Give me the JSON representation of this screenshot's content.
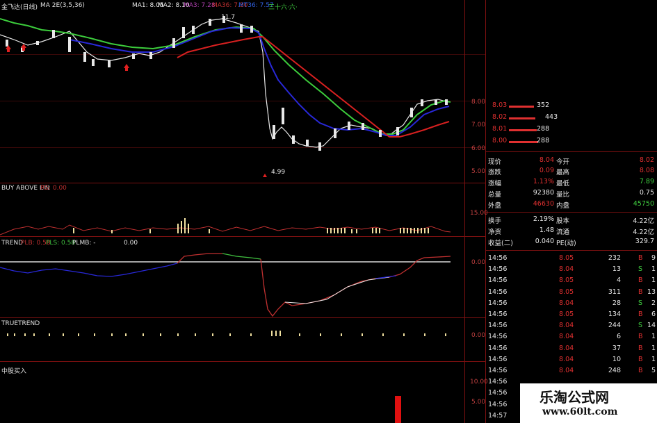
{
  "main_chart": {
    "title": "金飞达(日线)",
    "ma_name": "MA 2E(3,5,36)",
    "ma1": "MA1: 8.05",
    "ma2": "MA2: 8.10",
    "ma3": "MA3: 7.28",
    "ma36": "MA36: 7.30",
    "ma_extra": "MT36: 7.57",
    "signal_text": "三十六·六·",
    "high_label": "11.7",
    "low_label": "4.99",
    "y_ticks": [
      "8.00",
      "7.00",
      "6.00",
      "5.00"
    ],
    "colors": {
      "green": "#3ccc3c",
      "blue": "#2828d8",
      "red": "#d82020",
      "white": "#e8e8e8"
    }
  },
  "buy_panel": {
    "title": "BUY ABOVE LIN",
    "rs": "RS: 0.00",
    "y_tick": "15.00"
  },
  "trend_panel": {
    "title": "TREND",
    "plb": "PLB: 0.58",
    "pls": "PLS: 0.58",
    "plmb": "PLMB: -",
    "plmb_val": "0.00",
    "y_tick": "0.00"
  },
  "truetrend_panel": {
    "title": "TRUETREND",
    "y_tick": "0.00"
  },
  "bottom_panel": {
    "title": "中股买入",
    "y_ticks": [
      "10.00",
      "5.00"
    ]
  },
  "order_book": [
    {
      "price": "8.03",
      "vol": "352"
    },
    {
      "price": "8.02",
      "vol": "443"
    },
    {
      "price": "8.01",
      "vol": "288"
    },
    {
      "price": "8.00",
      "vol": "288"
    }
  ],
  "stats": [
    {
      "k1": "现价",
      "v1": "8.04",
      "k2": "今开",
      "v2": "8.02"
    },
    {
      "k1": "涨跌",
      "v1": "0.09",
      "k2": "最高",
      "v2": "8.08"
    },
    {
      "k1": "涨幅",
      "v1": "1.13%",
      "k2": "最低",
      "v2": "7.89"
    },
    {
      "k1": "总量",
      "v1": "92380",
      "k2": "量比",
      "v2": "0.75"
    },
    {
      "k1": "外盘",
      "v1": "46630",
      "k2": "内盘",
      "v2": "45750"
    },
    {
      "k1": "换手",
      "v1": "2.19%",
      "k2": "股本",
      "v2": "4.22亿"
    },
    {
      "k1": "净资",
      "v1": "1.48",
      "k2": "流通",
      "v2": "4.22亿"
    },
    {
      "k1": "收益(二)",
      "v1": "0.040",
      "k2": "PE(动)",
      "v2": "329.7"
    }
  ],
  "ticks": [
    {
      "time": "14:56",
      "price": "8.05",
      "vol": "232",
      "side": "B",
      "n": "9"
    },
    {
      "time": "14:56",
      "price": "8.04",
      "vol": "13",
      "side": "S",
      "n": "1"
    },
    {
      "time": "14:56",
      "price": "8.05",
      "vol": "4",
      "side": "B",
      "n": "1"
    },
    {
      "time": "14:56",
      "price": "8.05",
      "vol": "311",
      "side": "B",
      "n": "13"
    },
    {
      "time": "14:56",
      "price": "8.04",
      "vol": "28",
      "side": "S",
      "n": "2"
    },
    {
      "time": "14:56",
      "price": "8.05",
      "vol": "134",
      "side": "B",
      "n": "6"
    },
    {
      "time": "14:56",
      "price": "8.04",
      "vol": "244",
      "side": "S",
      "n": "14"
    },
    {
      "time": "14:56",
      "price": "8.04",
      "vol": "6",
      "side": "B",
      "n": "1"
    },
    {
      "time": "14:56",
      "price": "8.04",
      "vol": "37",
      "side": "B",
      "n": "1"
    },
    {
      "time": "14:56",
      "price": "8.04",
      "vol": "10",
      "side": "B",
      "n": "1"
    },
    {
      "time": "14:56",
      "price": "8.04",
      "vol": "248",
      "side": "B",
      "n": "5"
    },
    {
      "time": "14:56",
      "price": "",
      "vol": "",
      "side": "",
      "n": ""
    },
    {
      "time": "14:56",
      "price": "",
      "vol": "",
      "side": "",
      "n": ""
    },
    {
      "time": "14:56",
      "price": "",
      "vol": "",
      "side": "",
      "n": ""
    },
    {
      "time": "14:57",
      "price": "",
      "vol": "",
      "side": "",
      "n": ""
    }
  ],
  "watermark": {
    "cn": "乐淘公式网",
    "url": "www.60lt.com"
  }
}
